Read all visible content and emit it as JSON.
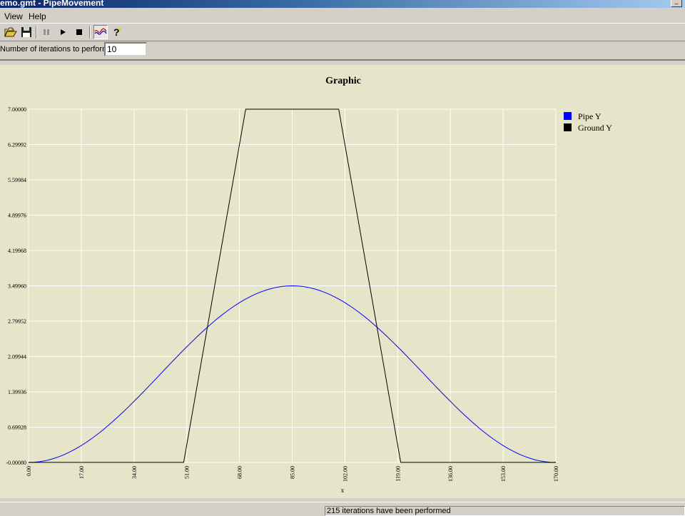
{
  "window": {
    "title": "emo.gmt - PipeMovement"
  },
  "menubar": {
    "items": [
      {
        "label": "View"
      },
      {
        "label": "Help"
      }
    ]
  },
  "toolbar": {
    "buttons": [
      {
        "icon": "open-folder-icon"
      },
      {
        "icon": "save-icon"
      },
      {
        "icon": "pause-icon"
      },
      {
        "icon": "play-icon"
      },
      {
        "icon": "stop-icon"
      },
      {
        "icon": "graph-icon",
        "pressed": true
      },
      {
        "icon": "help-icon"
      }
    ]
  },
  "iterations": {
    "label": "Number of iterations to perform",
    "value": "10"
  },
  "status": {
    "left": "",
    "right": "215 iterations have been performed"
  },
  "colors": {
    "pipe": "#0000ff",
    "ground": "#000000",
    "plot_bg": "#e6e5c9",
    "grid": "#ffffff"
  },
  "chart_data": {
    "type": "line",
    "title": "Graphic",
    "xlabel": "x",
    "ylabel": "",
    "xlim": [
      0,
      170
    ],
    "ylim": [
      -0.0008,
      7.0
    ],
    "x_ticks": [
      "0.00",
      "17.00",
      "34.00",
      "51.00",
      "68.00",
      "85.00",
      "102.00",
      "119.00",
      "136.00",
      "153.00",
      "170.00"
    ],
    "y_ticks": [
      "-0.00080",
      "0.69928",
      "1.39936",
      "2.09944",
      "2.79952",
      "3.49960",
      "4.19968",
      "4.89976",
      "5.59984",
      "6.29992",
      "7.00000"
    ],
    "grid": true,
    "legend_position": "right",
    "series": [
      {
        "name": "Pipe Y",
        "color": "#0000ff",
        "x": [
          0,
          10,
          20,
          30,
          40,
          50,
          60,
          70,
          80,
          85,
          90,
          100,
          110,
          120,
          130,
          140,
          150,
          160,
          170
        ],
        "y": [
          0.0,
          0.12,
          0.46,
          0.98,
          1.6,
          2.23,
          2.8,
          3.24,
          3.47,
          3.5,
          3.47,
          3.24,
          2.8,
          2.23,
          1.6,
          0.98,
          0.46,
          0.12,
          0.0
        ]
      },
      {
        "name": "Ground Y",
        "color": "#000000",
        "x": [
          0,
          50,
          70,
          100,
          120,
          170
        ],
        "y": [
          0,
          0,
          7.0,
          7.0,
          0,
          0
        ]
      }
    ]
  }
}
